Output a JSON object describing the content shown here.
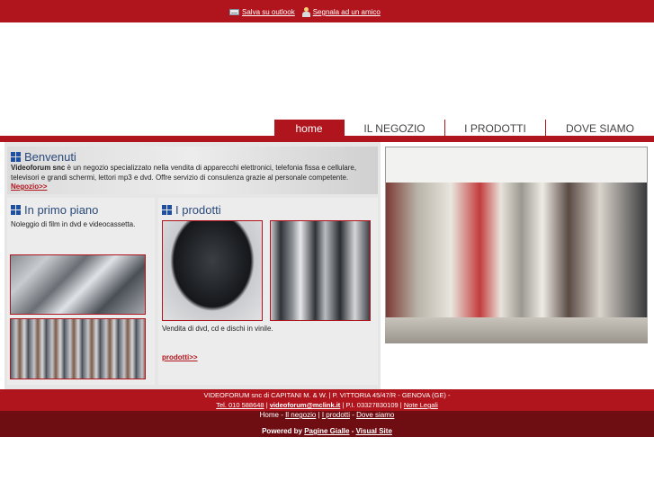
{
  "topbar": {
    "save_outlook": "Salva su outlook",
    "tell_friend": "Segnala ad un amico"
  },
  "nav": {
    "tabs": [
      {
        "label": "home",
        "active": true
      },
      {
        "label": "IL NEGOZIO",
        "active": false
      },
      {
        "label": "I PRODOTTI",
        "active": false
      },
      {
        "label": "DOVE SIAMO",
        "active": false
      }
    ]
  },
  "welcome": {
    "title": "Benvenuti",
    "company": "Videoforum snc",
    "text": " è un negozio specializzato nella vendita di apparecchi elettronici, telefonia fissa e cellulare, televisori e grandi schermi, lettori mp3 e dvd. Offre servizio di consulenza grazie al personale competente.",
    "more": "Negozio>>"
  },
  "primo_piano": {
    "title": "In primo piano",
    "text": "Noleggio di film in dvd e videocassetta."
  },
  "prodotti": {
    "title": "I prodotti",
    "text": "Vendita di dvd, cd e dischi in vinile.",
    "more": "prodotti>>"
  },
  "footer": {
    "line1": "VIDEOFORUM snc di CAPITANI M. & W. | P. VITTORIA 45/47/R - GENOVA (GE) -",
    "tel": "Tel. 010 588648",
    "email": "videoforum@mclink.it",
    "piva": " | P.I. 03327830109 | ",
    "legal": "Note Legali",
    "nav": [
      "Home",
      "Il negozio",
      "I prodotti",
      "Dove siamo"
    ],
    "powered_prefix": "Powered by ",
    "pagine_gialle": "Pagine Gialle",
    "visual_site": "Visual Site"
  },
  "colors": {
    "brand_red": "#b0141c",
    "dark_red": "#6e0d12",
    "heading_blue": "#2b4a7a"
  }
}
